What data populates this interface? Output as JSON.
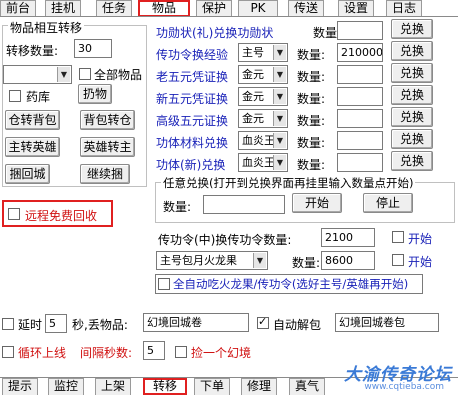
{
  "top_tabs": [
    {
      "label": "前台"
    },
    {
      "label": "挂机"
    },
    {
      "label": "任务"
    },
    {
      "label": "物品"
    },
    {
      "label": "保护"
    },
    {
      "label": "PK"
    },
    {
      "label": "传送"
    },
    {
      "label": "设置"
    },
    {
      "label": "日志"
    }
  ],
  "active_top_tab": "物品",
  "transfer_group": {
    "title": "物品相互转移",
    "count_label": "转移数量:",
    "count_value": "30",
    "item_select": "",
    "all_items_label": "全部物品",
    "warehouse_label": "药库",
    "items_button": "扔物",
    "buttons": [
      {
        "label": "仓转背包"
      },
      {
        "label": "背包转仓"
      },
      {
        "label": "主转英雄"
      },
      {
        "label": "英雄转主"
      },
      {
        "label": "捆回城"
      },
      {
        "label": "继续捆"
      }
    ]
  },
  "exchange_rows": [
    {
      "name": "功勋状(礼)兑换功勋状",
      "select": "",
      "qty_label": "数量:",
      "qty": "",
      "button": "兑换"
    },
    {
      "name": "传功令换经验",
      "select": "主号",
      "qty_label": "数量:",
      "qty": "210000",
      "button": "兑换"
    },
    {
      "name": "老五元凭证换",
      "select": "金元",
      "qty_label": "数量:",
      "qty": "",
      "button": "兑换"
    },
    {
      "name": "新五元凭证换",
      "select": "金元",
      "qty_label": "数量:",
      "qty": "",
      "button": "兑换"
    },
    {
      "name": "高级五元证换",
      "select": "金元",
      "qty_label": "数量:",
      "qty": "",
      "button": "兑换"
    },
    {
      "name": "功体材料兑换",
      "select": "血炎王",
      "qty_label": "数量:",
      "qty": "",
      "button": "兑换"
    },
    {
      "name": "功体(新)兑换",
      "select": "血炎王",
      "qty_label": "数量:",
      "qty": "",
      "button": "兑换"
    }
  ],
  "any_exchange": {
    "title": "任意兑换(打开到兑换界面再挂里输入数量点开始)",
    "qty_label": "数量:",
    "qty": "",
    "start": "开始",
    "stop": "停止"
  },
  "remote_recycle": {
    "label": "远程免费回收"
  },
  "transfer_medal": {
    "label": "传功令(中)换传功令数量:",
    "value": "2100",
    "start_label": "开始",
    "select": "主号包月火龙果",
    "qty_label": "数量:",
    "qty": "8600",
    "start2_label": "开始"
  },
  "auto_eat": {
    "label": "全自动吃火龙果/传功令(选好主号/英雄再开始)"
  },
  "delay": {
    "label": "延时",
    "value": "5",
    "suffix": "秒,丢物品:",
    "drop_item": "幻境回城卷",
    "auto_unpack_label": "自动解包",
    "unpack_item": "幻境回城卷包"
  },
  "loop_online": {
    "label": "循环上线",
    "interval_label": "间隔秒数:",
    "interval": "5",
    "pick_label": "捡一个幻境"
  },
  "bottom_tabs": [
    {
      "label": "提示"
    },
    {
      "label": "监控"
    },
    {
      "label": "上架"
    },
    {
      "label": "转移"
    },
    {
      "label": "下单"
    },
    {
      "label": "修理"
    },
    {
      "label": "真气"
    }
  ],
  "active_bottom_tab": "转移",
  "watermark": {
    "text": "大渝传奇论坛",
    "url": "www.cqtieba.com"
  },
  "colors": {
    "accent_red": "#e02020",
    "label_blue": "#1a22b8",
    "text_red": "#d01010"
  }
}
